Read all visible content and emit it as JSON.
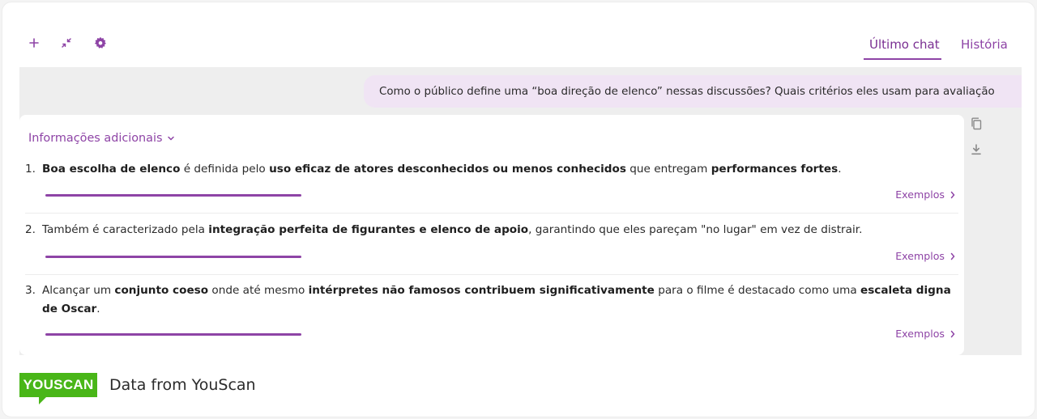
{
  "toolbar": {
    "icons": [
      "plus-icon",
      "collapse-icon",
      "gear-icon"
    ],
    "tabs": [
      {
        "label": "Último chat",
        "active": true
      },
      {
        "label": "História",
        "active": false
      }
    ]
  },
  "chat": {
    "user_question": "Como o público define uma “boa direção de elenco” nessas discussões? Quais critérios eles usam para avaliação",
    "more_info_label": "Informações adicionais",
    "examples_label": "Exemplos",
    "side_tools": [
      "copy-icon",
      "download-icon"
    ],
    "items": [
      {
        "number": "1.",
        "parts": [
          {
            "b": "Boa escolha de elenco"
          },
          {
            "t": " é definida pelo "
          },
          {
            "b": "uso eficaz de atores desconhecidos ou menos conhecidos"
          },
          {
            "t": " que entregam "
          },
          {
            "b": "performances fortes"
          },
          {
            "t": "."
          }
        ]
      },
      {
        "number": "2.",
        "parts": [
          {
            "t": "Também é caracterizado pela "
          },
          {
            "b": "integração perfeita de figurantes e elenco de apoio"
          },
          {
            "t": ", garantindo que eles pareçam \"no lugar\" em vez de distrair."
          }
        ]
      },
      {
        "number": "3.",
        "parts": [
          {
            "t": "Alcançar um "
          },
          {
            "b": "conjunto coeso"
          },
          {
            "t": " onde até mesmo "
          },
          {
            "b": "intérpretes não famosos contribuem significativamente"
          },
          {
            "t": " para o filme é destacado como uma "
          },
          {
            "b": "escaleta digna de Oscar"
          },
          {
            "t": "."
          }
        ]
      }
    ]
  },
  "footer": {
    "brand": "YOUSCAN",
    "text": "Data from YouScan"
  },
  "colors": {
    "accent": "#8e44a6",
    "brand_green": "#49b618",
    "bubble": "#f0e4f4",
    "panel_bg": "#eeeeee"
  }
}
